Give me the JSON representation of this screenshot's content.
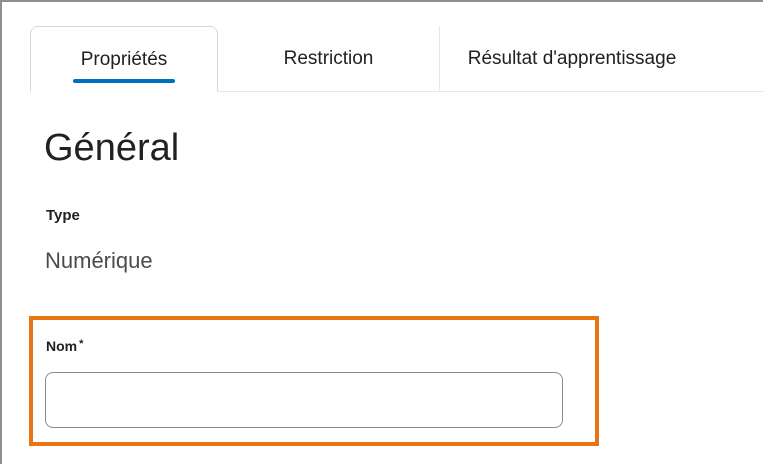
{
  "tabs": [
    {
      "label": "Propriétés",
      "active": true
    },
    {
      "label": "Restriction",
      "active": false
    },
    {
      "label": "Résultat d'apprentissage",
      "active": false
    }
  ],
  "section": {
    "heading": "Général"
  },
  "type_field": {
    "label": "Type",
    "value": "Numérique"
  },
  "name_field": {
    "label": "Nom",
    "required_marker": "*",
    "value": "",
    "placeholder": ""
  },
  "colors": {
    "accent": "#006fbf",
    "highlight": "#e87511",
    "text": "#202122"
  }
}
